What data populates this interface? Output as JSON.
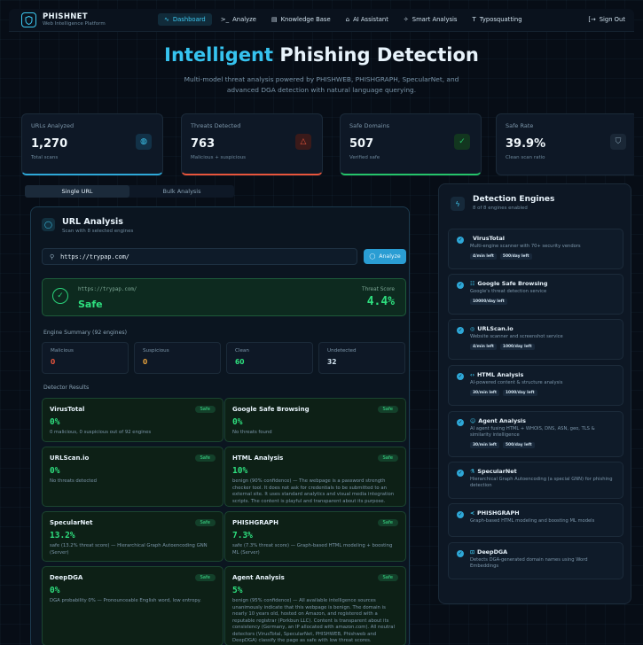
{
  "nav": {
    "brand_title": "PHISHNET",
    "brand_subtitle": "Web Intelligence Platform",
    "links": [
      {
        "label": "Dashboard",
        "icon": "activity-icon"
      },
      {
        "label": "Analyze",
        "icon": "terminal-icon"
      },
      {
        "label": "Knowledge Base",
        "icon": "book-icon"
      },
      {
        "label": "AI Assistant",
        "icon": "bot-icon"
      },
      {
        "label": "Smart Analysis",
        "icon": "sparkles-icon"
      },
      {
        "label": "Typosquatting",
        "icon": "text-icon"
      }
    ],
    "sign_out": "Sign Out"
  },
  "hero": {
    "title_highlight": "Intelligent",
    "title_rest": " Phishing Detection",
    "subtitle": "Multi-model threat analysis powered by PHISHWEB, PHISHGRAPH, SpecularNet, and advanced DGA detection with natural language querying."
  },
  "stats": [
    {
      "label": "URLs Analyzed",
      "value": "1,270",
      "sub": "Total scans",
      "icon": "globe-icon",
      "color": "#2ea8d8"
    },
    {
      "label": "Threats Detected",
      "value": "763",
      "sub": "Malicious + suspicious",
      "icon": "alert-triangle-icon",
      "color": "#e8553c"
    },
    {
      "label": "Safe Domains",
      "value": "507",
      "sub": "Verified safe",
      "icon": "check-circle-icon",
      "color": "#25c46a"
    },
    {
      "label": "Safe Rate",
      "value": "39.9%",
      "sub": "Clean scan ratio",
      "icon": "shield-icon",
      "color": "#8aa3b5"
    }
  ],
  "tabs": [
    "Single URL",
    "Bulk Analysis"
  ],
  "analysis": {
    "title": "URL Analysis",
    "subtitle": "Scan with 8 selected engines",
    "url_value": "https://trypap.com/",
    "analyze_label": "Analyze",
    "result": {
      "url": "https://trypap.com/",
      "verdict": "Safe",
      "score_label": "Threat Score",
      "score": "4.4%"
    },
    "engine_summary_label": "Engine Summary (92 engines)",
    "summary": [
      {
        "label": "Malicious",
        "value": "0",
        "color": "#e8553c"
      },
      {
        "label": "Suspicious",
        "value": "0",
        "color": "#e8a23c"
      },
      {
        "label": "Clean",
        "value": "60",
        "color": "#2ee07f"
      },
      {
        "label": "Undetected",
        "value": "32",
        "color": "#cfe0ec"
      }
    ],
    "detector_results_label": "Detector Results",
    "detectors": [
      {
        "name": "VirusTotal",
        "badge": "Safe",
        "score": "0%",
        "desc": "0 malicious, 0 suspicious out of 92 engines"
      },
      {
        "name": "Google Safe Browsing",
        "badge": "Safe",
        "score": "0%",
        "desc": "No threats found"
      },
      {
        "name": "URLScan.io",
        "badge": "Safe",
        "score": "0%",
        "desc": "No threats detected"
      },
      {
        "name": "HTML Analysis",
        "badge": "Safe",
        "score": "10%",
        "desc": "benign (90% confidence) — The webpage is a password strength checker tool. It does not ask for credentials to be submitted to an external site. It uses standard analytics and visual media integration scripts. The content is playful and transparent about its purpose."
      },
      {
        "name": "SpecularNet",
        "badge": "Safe",
        "score": "13.2%",
        "desc": "safe (13.2% threat score) — Hierarchical Graph Autoencoding GNN (Server)"
      },
      {
        "name": "PHISHGRAPH",
        "badge": "Safe",
        "score": "7.3%",
        "desc": "safe (7.3% threat score) — Graph-based HTML modeling + boosting ML (Server)"
      },
      {
        "name": "DeepDGA",
        "badge": "Safe",
        "score": "0%",
        "desc": "DGA probability 0% — Pronounceable English word, low entropy."
      },
      {
        "name": "Agent Analysis",
        "badge": "Safe",
        "score": "5%",
        "desc": "benign (95% confidence) — All available intelligence sources unanimously indicate that this webpage is benign. The domain is nearly 10 years old, hosted on Amazon, and registered with a reputable registrar (Porkbun LLC). Content is transparent about its consistency (Germany, an IP allocated with amazon.com). All neutral detectors (VirusTotal, SpecularNet, PHISHWEB, Phishweb and DeepDGA) classify the page as safe with low threat scores."
      }
    ]
  },
  "engines": {
    "title": "Detection Engines",
    "subtitle": "8 of 8 engines enabled",
    "items": [
      {
        "name": "VirusTotal",
        "desc": "Multi-engine scanner with 70+ security vendors",
        "tags": [
          "4/min left",
          "500/day left"
        ],
        "icon": ""
      },
      {
        "name": "Google Safe Browsing",
        "desc": "Google's threat detection service",
        "tags": [
          "10000/day left"
        ],
        "icon": "☷"
      },
      {
        "name": "URLScan.io",
        "desc": "Website scanner and screenshot service",
        "tags": [
          "4/min left",
          "1000/day left"
        ],
        "icon": "◎"
      },
      {
        "name": "HTML Analysis",
        "desc": "AI-powered content & structure analysis",
        "tags": [
          "30/min left",
          "1000/day left"
        ],
        "icon": "‹›"
      },
      {
        "name": "Agent Analysis",
        "desc": "AI agent fusing HTML + WHOIS, DNS, ASN, geo, TLS & similarity intelligence",
        "tags": [
          "30/min left",
          "500/day left"
        ],
        "icon": "☺"
      },
      {
        "name": "SpecularNet",
        "desc": "Hierarchical Graph Autoencoding (a special GNN) for phishing detection",
        "tags": [],
        "icon": "⚗"
      },
      {
        "name": "PHISHGRAPH",
        "desc": "Graph-based HTML modeling and boosting ML models",
        "tags": [],
        "icon": "≺"
      },
      {
        "name": "DeepDGA",
        "desc": "Detects DGA-generated domain names using Word Embeddings",
        "tags": [],
        "icon": "⊡"
      }
    ]
  }
}
